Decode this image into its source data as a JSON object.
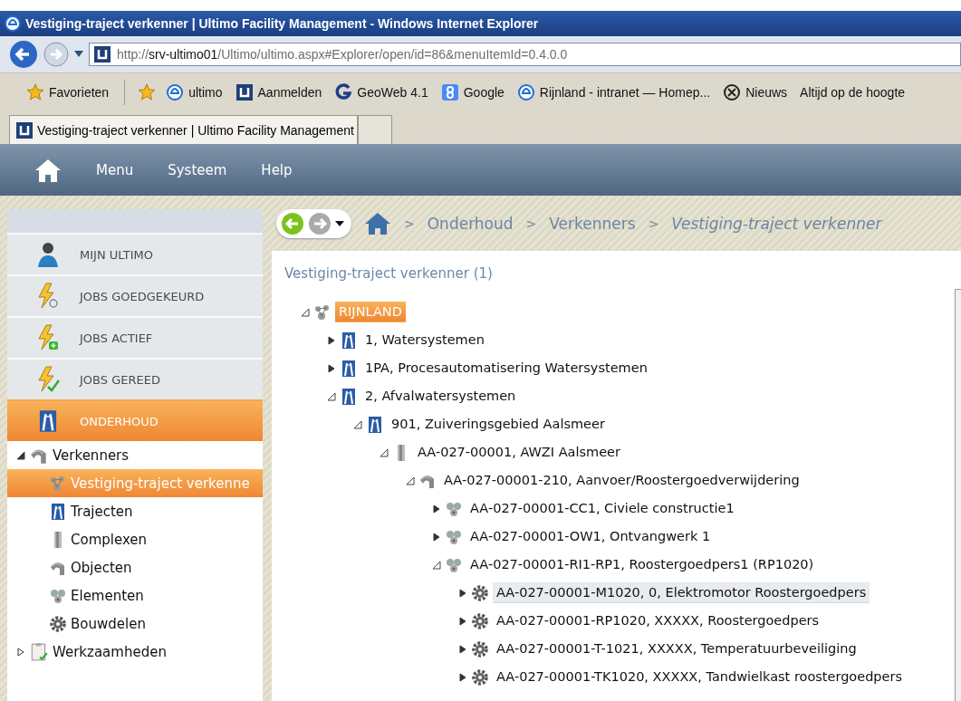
{
  "window": {
    "title": "Vestiging-traject verkenner | Ultimo Facility Management - Windows Internet Explorer"
  },
  "address": {
    "prefix": "http://",
    "host": "srv-ultimo01",
    "path": "/Ultimo/ultimo.aspx#Explorer/open/id=86&menuItemId=0.4.0.0"
  },
  "favorites": [
    {
      "kind": "star",
      "label": "Favorieten"
    },
    {
      "kind": "ie",
      "label": "ultimo"
    },
    {
      "kind": "ultimo",
      "label": "Aanmelden"
    },
    {
      "kind": "geo",
      "label": "GeoWeb 4.1"
    },
    {
      "kind": "google",
      "label": "Google"
    },
    {
      "kind": "ie",
      "label": "Rijnland - intranet — Homep..."
    },
    {
      "kind": "news",
      "label": "Nieuws"
    },
    {
      "kind": "none",
      "label": "Altijd op de hoogte"
    }
  ],
  "browser_tabs": [
    {
      "label": "Vestiging-traject verkenner | Ultimo Facility Management",
      "selected": true
    }
  ],
  "app_menu": [
    "Menu",
    "Systeem",
    "Help"
  ],
  "breadcrumb": [
    {
      "separator": ">",
      "label": "Onderhoud",
      "current": false
    },
    {
      "separator": ">",
      "label": "Verkenners",
      "current": false
    },
    {
      "separator": ">",
      "label": "Vestiging-traject verkenner",
      "current": true
    }
  ],
  "sidebar": {
    "items": [
      {
        "kind": "user",
        "label": "MIJN ULTIMO",
        "selected": false
      },
      {
        "kind": "bolt-search",
        "label": "JOBS GOEDGEKEURD",
        "selected": false
      },
      {
        "kind": "bolt-add",
        "label": "JOBS ACTIEF",
        "selected": false
      },
      {
        "kind": "bolt-check",
        "label": "JOBS GEREED",
        "selected": false
      },
      {
        "kind": "traject",
        "label": "ONDERHOUD",
        "selected": true
      }
    ],
    "tree": [
      {
        "kind": "object",
        "label": "Verkenners",
        "expanded": true,
        "children": [
          {
            "kind": "org",
            "label": "Vestiging-traject verkenne",
            "selected": true
          },
          {
            "kind": "traject",
            "label": "Trajecten",
            "selected": false
          },
          {
            "kind": "complex",
            "label": "Complexen",
            "selected": false
          },
          {
            "kind": "object",
            "label": "Objecten",
            "selected": false
          },
          {
            "kind": "element",
            "label": "Elementen",
            "selected": false
          },
          {
            "kind": "part",
            "label": "Bouwdelen",
            "selected": false
          }
        ]
      },
      {
        "kind": "task",
        "label": "Werkzaamheden",
        "expanded": false
      }
    ]
  },
  "explorer": {
    "title": "Vestiging-traject verkenner (1)",
    "tree": [
      {
        "kind": "org",
        "label": "RIJNLAND",
        "expanded": true,
        "selected": true,
        "hover": false,
        "children": [
          {
            "kind": "traject",
            "label": "1, Watersystemen",
            "expanded": false,
            "selected": false,
            "hover": false
          },
          {
            "kind": "traject",
            "label": "1PA, Procesautomatisering Watersystemen",
            "expanded": false,
            "selected": false,
            "hover": false
          },
          {
            "kind": "traject",
            "label": "2, Afvalwatersystemen",
            "expanded": true,
            "selected": false,
            "hover": false,
            "children": [
              {
                "kind": "traject",
                "label": "901, Zuiveringsgebied Aalsmeer",
                "expanded": true,
                "selected": false,
                "hover": false,
                "children": [
                  {
                    "kind": "complex",
                    "label": "AA-027-00001, AWZI Aalsmeer",
                    "expanded": true,
                    "selected": false,
                    "hover": false,
                    "children": [
                      {
                        "kind": "object",
                        "label": "AA-027-00001-210, Aanvoer/Roostergoedverwijdering",
                        "expanded": true,
                        "selected": false,
                        "hover": false,
                        "children": [
                          {
                            "kind": "element",
                            "label": "AA-027-00001-CC1, Civiele constructie1",
                            "expanded": false,
                            "selected": false,
                            "hover": false
                          },
                          {
                            "kind": "element",
                            "label": "AA-027-00001-OW1, Ontvangwerk 1",
                            "expanded": false,
                            "selected": false,
                            "hover": false
                          },
                          {
                            "kind": "element",
                            "label": "AA-027-00001-RI1-RP1, Roostergoedpers1 (RP1020)",
                            "expanded": true,
                            "selected": false,
                            "hover": false,
                            "children": [
                              {
                                "kind": "part",
                                "label": "AA-027-00001-M1020, 0, Elektromotor Roostergoedpers",
                                "expanded": false,
                                "selected": false,
                                "hover": true
                              },
                              {
                                "kind": "part",
                                "label": "AA-027-00001-RP1020, XXXXX, Roostergoedpers",
                                "expanded": false,
                                "selected": false,
                                "hover": false
                              },
                              {
                                "kind": "part",
                                "label": "AA-027-00001-T-1021, XXXXX, Temperatuurbeveiliging",
                                "expanded": false,
                                "selected": false,
                                "hover": false
                              },
                              {
                                "kind": "part",
                                "label": "AA-027-00001-TK1020, XXXXX, Tandwielkast roostergoedpers",
                                "expanded": false,
                                "selected": false,
                                "hover": false
                              }
                            ]
                          }
                        ]
                      }
                    ]
                  }
                ]
              }
            ]
          }
        ]
      }
    ]
  }
}
